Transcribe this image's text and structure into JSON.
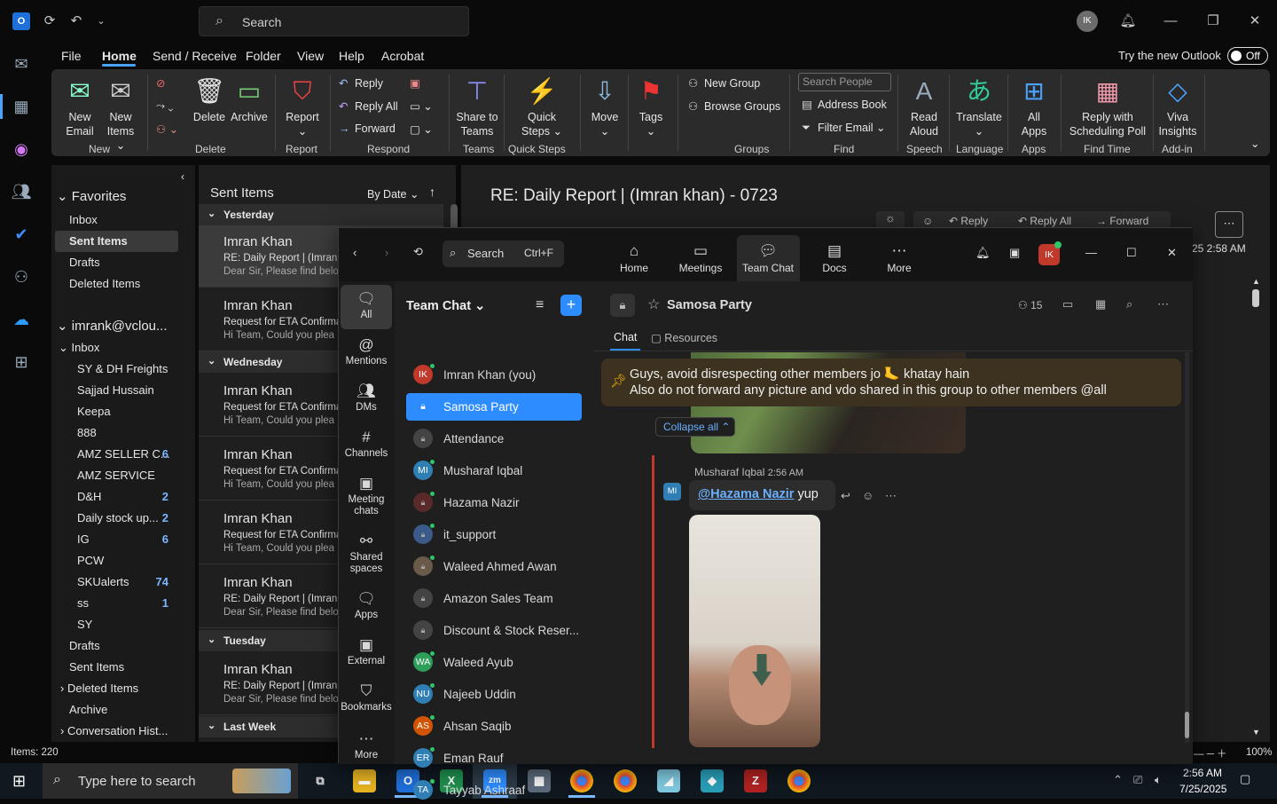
{
  "outlook": {
    "search": "Search",
    "avatar": "IK",
    "menu": [
      "File",
      "Home",
      "Send / Receive",
      "Folder",
      "View",
      "Help",
      "Acrobat"
    ],
    "try_new": "Try the new Outlook",
    "toggle": "Off",
    "ribbon": {
      "new_email": [
        "New",
        "Email"
      ],
      "new_items": [
        "New",
        "Items"
      ],
      "delete": "Delete",
      "archive": "Archive",
      "report": "Report",
      "reply": "Reply",
      "reply_all": "Reply All",
      "forward": "Forward",
      "share_teams": [
        "Share to",
        "Teams"
      ],
      "quick_steps": [
        "Quick",
        "Steps"
      ],
      "move": "Move",
      "tags": "Tags",
      "new_group": "New Group",
      "browse_groups": "Browse Groups",
      "search_people": "Search People",
      "address_book": "Address Book",
      "filter_email": "Filter Email",
      "read_aloud": [
        "Read",
        "Aloud"
      ],
      "translate": "Translate",
      "all_apps": [
        "All",
        "Apps"
      ],
      "reply_poll": [
        "Reply with",
        "Scheduling Poll"
      ],
      "viva": [
        "Viva",
        "Insights"
      ],
      "groups": [
        "New",
        "Delete",
        "Report",
        "Respond",
        "Teams",
        "Quick Steps",
        "Move",
        "Tags",
        "Groups",
        "Find",
        "Speech",
        "Language",
        "Apps",
        "Find Time",
        "Add-in"
      ]
    },
    "folders": {
      "favorites": "Favorites",
      "fav_items": [
        "Inbox",
        "Sent Items",
        "Drafts",
        "Deleted Items"
      ],
      "account": "imrank@vclou...",
      "inbox": "Inbox",
      "subfolders": [
        {
          "name": "SY & DH Freights",
          "count": ""
        },
        {
          "name": "Sajjad Hussain",
          "count": ""
        },
        {
          "name": "Keepa",
          "count": ""
        },
        {
          "name": "888",
          "count": ""
        },
        {
          "name": "AMZ SELLER C...",
          "count": "6"
        },
        {
          "name": "AMZ SERVICE",
          "count": ""
        },
        {
          "name": "D&H",
          "count": "2"
        },
        {
          "name": "Daily stock up...",
          "count": "2"
        },
        {
          "name": "IG",
          "count": "6"
        },
        {
          "name": "PCW",
          "count": ""
        },
        {
          "name": "SKUalerts",
          "count": "74"
        },
        {
          "name": "ss",
          "count": "1"
        },
        {
          "name": "SY",
          "count": ""
        }
      ],
      "bottom": [
        "Drafts",
        "Sent Items",
        "Deleted Items",
        "Archive",
        "Conversation Hist..."
      ]
    },
    "list": {
      "title": "Sent Items",
      "sort": "By Date",
      "groups": [
        "Yesterday",
        "Wednesday",
        "Tuesday",
        "Last Week"
      ],
      "items": [
        {
          "from": "Imran Khan",
          "subj": "RE: Daily Report | (Imran",
          "prev": "Dear Sir,  Please find belo"
        },
        {
          "from": "Imran Khan",
          "subj": "Request for ETA Confirma",
          "prev": "Hi Team,  Could you plea"
        },
        {
          "from": "Imran Khan",
          "subj": "Request for ETA Confirma",
          "prev": "Hi Team,  Could you plea"
        },
        {
          "from": "Imran Khan",
          "subj": "Request for ETA Confirma",
          "prev": "Hi Team,  Could you plea"
        },
        {
          "from": "Imran Khan",
          "subj": "Request for ETA Confirma",
          "prev": "Hi Team,  Could you plea"
        },
        {
          "from": "Imran Khan",
          "subj": "RE: Daily Report | (Imran",
          "prev": "Dear Sir,  Please find belo"
        },
        {
          "from": "Imran Khan",
          "subj": "RE: Daily Report | (Imran",
          "prev": "Dear Sir,  Please find belo"
        }
      ]
    },
    "reading": {
      "title": "RE:  Daily Report | (Imran khan) - 0723",
      "time": "25 2:58 AM",
      "reply": "Reply",
      "reply_all": "Reply All",
      "forward": "Forward"
    },
    "status": {
      "items": "Items: 220",
      "zoom": "100%"
    }
  },
  "zoom": {
    "search": "Search",
    "shortcut": "Ctrl+F",
    "nav": [
      "Home",
      "Meetings",
      "Team Chat",
      "Docs",
      "More"
    ],
    "avatar": "IK",
    "side": [
      "All",
      "Mentions",
      "DMs",
      "Channels",
      "Meeting chats",
      "Shared spaces",
      "Apps",
      "External",
      "Bookmarks",
      "More"
    ],
    "list_title": "Team Chat",
    "chats": [
      {
        "name": "Imran Khan (you)",
        "av": "IK",
        "color": "#c0392b"
      },
      {
        "name": "Samosa Party",
        "av": "",
        "color": ""
      },
      {
        "name": "Attendance",
        "av": "",
        "color": "#444"
      },
      {
        "name": "Musharaf Iqbal",
        "av": "MI",
        "color": "#2f7fb5"
      },
      {
        "name": "Hazama Nazir",
        "av": "",
        "color": "#5a2a2a"
      },
      {
        "name": "it_support",
        "av": "",
        "color": "#3a5a8a"
      },
      {
        "name": "Waleed Ahmed Awan",
        "av": "",
        "color": "#6a5a4a"
      },
      {
        "name": "Amazon Sales Team",
        "av": "",
        "color": "#444"
      },
      {
        "name": "Discount & Stock Reser...",
        "av": "",
        "color": "#444"
      },
      {
        "name": "Waleed Ayub",
        "av": "WA",
        "color": "#2e9e5b"
      },
      {
        "name": "Najeeb Uddin",
        "av": "NU",
        "color": "#2f7fb5"
      },
      {
        "name": "Ahsan Saqib",
        "av": "AS",
        "color": "#d35400"
      },
      {
        "name": "Eman Rauf",
        "av": "ER",
        "color": "#2f7fb5"
      },
      {
        "name": "Tayyab Ashraaf",
        "av": "TA",
        "color": "#2f7fb5"
      }
    ],
    "channel": "Samosa Party",
    "members": "15",
    "tabs": [
      "Chat",
      "Resources"
    ],
    "pinned": [
      "Guys, avoid disrespecting other members jo 🦶 khatay hain",
      "Also do not forward any picture and vdo shared in this group to other members @all"
    ],
    "collapse": "Collapse all",
    "msg": {
      "sender": "Musharaf Iqbal",
      "time": "2:56 AM",
      "mention": "@Hazama Nazir",
      "text": "yup",
      "av": "MI"
    }
  },
  "taskbar": {
    "search": "Type here to search",
    "time": "2:56 AM",
    "date": "7/25/2025"
  }
}
